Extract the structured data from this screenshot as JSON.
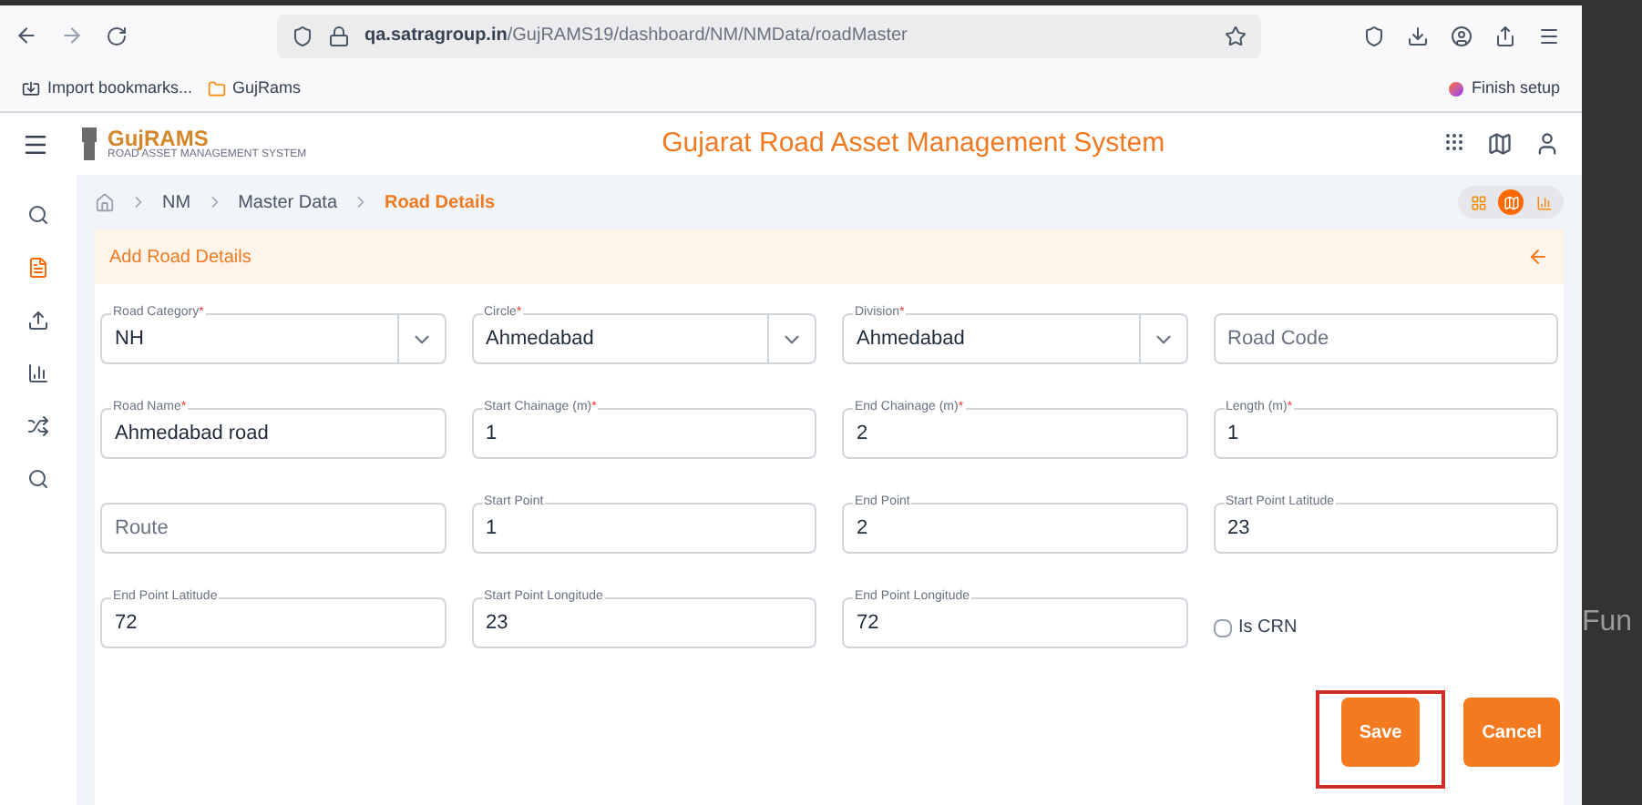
{
  "browser": {
    "url_host": "qa.satragroup.in",
    "url_path": "/GujRAMS19/dashboard/NM/NMData/roadMaster",
    "bookmarks": [
      "Import bookmarks...",
      "GujRams"
    ],
    "finish_setup": "Finish setup"
  },
  "app": {
    "logo": "GujRAMS",
    "logo_sub": "ROAD ASSET MANAGEMENT SYSTEM",
    "title": "Gujarat Road Asset Management System"
  },
  "sidebar": {
    "items": [
      {
        "selected": false
      },
      {
        "selected": true
      },
      {
        "selected": false
      },
      {
        "selected": false
      },
      {
        "selected": false
      },
      {
        "selected": false
      }
    ]
  },
  "breadcrumb": [
    {
      "label": "NM",
      "current": false
    },
    {
      "label": "Master Data",
      "current": false
    },
    {
      "label": "Road Details",
      "current": true
    }
  ],
  "view_toggles": [
    {
      "selected": false
    },
    {
      "selected": true
    },
    {
      "selected": false
    }
  ],
  "card": {
    "title": "Add Road Details"
  },
  "fields": [
    {
      "kind": "select",
      "label": "Road Category",
      "required": "*",
      "value": "NH"
    },
    {
      "kind": "select",
      "label": "Circle",
      "required": "*",
      "value": "Ahmedabad"
    },
    {
      "kind": "select",
      "label": "Division",
      "required": "*",
      "value": "Ahmedabad"
    },
    {
      "kind": "input",
      "placeholder": "Road Code"
    },
    {
      "kind": "input",
      "label": "Road Name",
      "required": "*",
      "value": "Ahmedabad road"
    },
    {
      "kind": "input",
      "label": "Start Chainage (m)",
      "required": "*",
      "value": "1"
    },
    {
      "kind": "input",
      "label": "End Chainage (m)",
      "required": "*",
      "value": "2"
    },
    {
      "kind": "input",
      "label": "Length (m)",
      "required": "*",
      "value": "1"
    },
    {
      "kind": "input",
      "placeholder": "Route"
    },
    {
      "kind": "input",
      "label": "Start Point",
      "value": "1"
    },
    {
      "kind": "input",
      "label": "End Point",
      "value": "2"
    },
    {
      "kind": "input",
      "label": "Start Point Latitude",
      "value": "23"
    },
    {
      "kind": "input",
      "label": "End Point Latitude",
      "value": "72"
    },
    {
      "kind": "input",
      "label": "Start Point Longitude",
      "value": "23"
    },
    {
      "kind": "input",
      "label": "End Point Longitude",
      "value": "72"
    },
    {
      "kind": "checkbox",
      "label": "Is CRN",
      "checked": false
    }
  ],
  "buttons": [
    {
      "label": "Save",
      "highlighted": true
    },
    {
      "label": "Cancel",
      "highlighted": false
    }
  ],
  "margin_text": "Fun"
}
